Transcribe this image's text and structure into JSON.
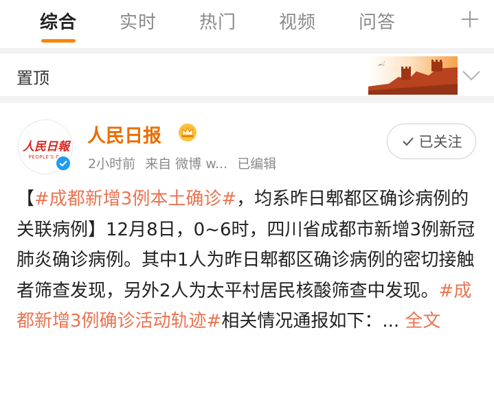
{
  "tabs": [
    {
      "label": "综合",
      "active": true
    },
    {
      "label": "实时",
      "active": false
    },
    {
      "label": "热门",
      "active": false
    },
    {
      "label": "视频",
      "active": false
    },
    {
      "label": "问答",
      "active": false
    }
  ],
  "pinned": {
    "label": "置顶"
  },
  "post": {
    "author": "人民日报",
    "avatar_logo": "人民日報",
    "avatar_sub": "PEOPLE'S DA",
    "time": "2小时前",
    "source": "来自 微博 w...",
    "edited": "已编辑",
    "follow_label": "已关注",
    "bracket_open": "【",
    "topic_1": "#成都新增3例本土确诊#",
    "text_1": "，均系昨日郫都区确诊病例的关联病例】12月8日，0~6时，四川省成都市新增3例新冠肺炎确诊病例。其中1人为昨日郫都区确诊病例的密切接触者筛查发现，另外2人为太平村居民核酸筛查中发现。",
    "topic_2": "#成都新增3例确诊活动轨迹#",
    "text_2": "相关情况通报如下：...",
    "full_text_link": "全文"
  },
  "colors": {
    "accent": "#ff8200",
    "author": "#ea6e00",
    "topic": "#eb7350",
    "verified": "#1d9bf0"
  },
  "icons": [
    "plus-icon",
    "chevron-down-icon",
    "crown-icon",
    "verified-icon",
    "check-icon"
  ]
}
